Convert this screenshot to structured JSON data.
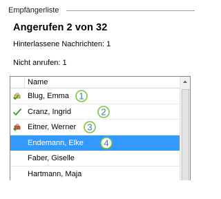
{
  "group": {
    "title": "Empfängerliste"
  },
  "summary": {
    "called": "Angerufen 2 von 32",
    "messages_left": "Hinterlassene Nachrichten: 1",
    "do_not_call": "Nicht anrufen: 1"
  },
  "list": {
    "header": {
      "name": "Name"
    },
    "rows": [
      {
        "name": "Blug, Emma",
        "status_icon": "voicemail-left-icon",
        "callout": "1"
      },
      {
        "name": "Cranz, Ingrid",
        "status_icon": "called-check-icon",
        "callout": "2"
      },
      {
        "name": "Eitner, Werner",
        "status_icon": "do-not-call-icon",
        "callout": "3"
      },
      {
        "name": "Endemann, Elke",
        "status_icon": "",
        "callout": "4",
        "selected": true
      },
      {
        "name": "Faber, Giselle",
        "status_icon": ""
      },
      {
        "name": "Hartmann, Maja",
        "status_icon": ""
      }
    ]
  },
  "colors": {
    "selection": "#3399ff",
    "callout_ring": "#7cc242"
  }
}
